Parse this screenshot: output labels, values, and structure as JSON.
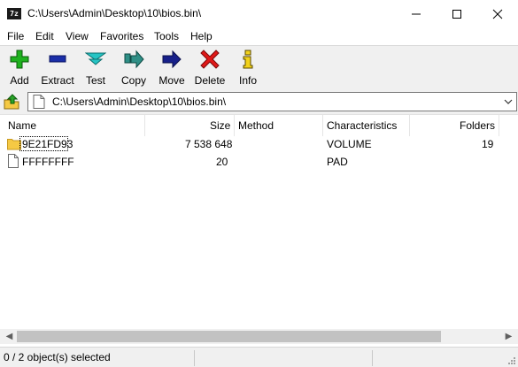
{
  "window": {
    "title": "C:\\Users\\Admin\\Desktop\\10\\bios.bin\\",
    "app_icon_text": "7z"
  },
  "menu": [
    "File",
    "Edit",
    "View",
    "Favorites",
    "Tools",
    "Help"
  ],
  "toolbar": [
    {
      "label": "Add",
      "icon": "plus-icon"
    },
    {
      "label": "Extract",
      "icon": "minus-icon"
    },
    {
      "label": "Test",
      "icon": "double-chevron-down-icon"
    },
    {
      "label": "Copy",
      "icon": "copy-arrow-icon"
    },
    {
      "label": "Move",
      "icon": "move-arrow-icon"
    },
    {
      "label": "Delete",
      "icon": "delete-x-icon"
    },
    {
      "label": "Info",
      "icon": "info-icon"
    }
  ],
  "address": {
    "path": "C:\\Users\\Admin\\Desktop\\10\\bios.bin\\"
  },
  "columns": {
    "name": "Name",
    "size": "Size",
    "method": "Method",
    "characteristics": "Characteristics",
    "folders": "Folders"
  },
  "rows": [
    {
      "name": "9E21FD93",
      "size": "7 538 648",
      "method": "",
      "characteristics": "VOLUME",
      "folders": "19",
      "icon": "folder-icon"
    },
    {
      "name": "FFFFFFFF",
      "size": "20",
      "method": "",
      "characteristics": "PAD",
      "folders": "",
      "icon": "file-icon"
    }
  ],
  "status": {
    "selection": "0 / 2 object(s) selected"
  },
  "colors": {
    "add_green": "#1fb11f",
    "extract_blue": "#1a2ea8",
    "test_cyan": "#26c4c4",
    "move_navy": "#17208a",
    "delete_red": "#e01818",
    "info_yellow": "#f2d21b",
    "folder_yellow": "#f5c944"
  }
}
